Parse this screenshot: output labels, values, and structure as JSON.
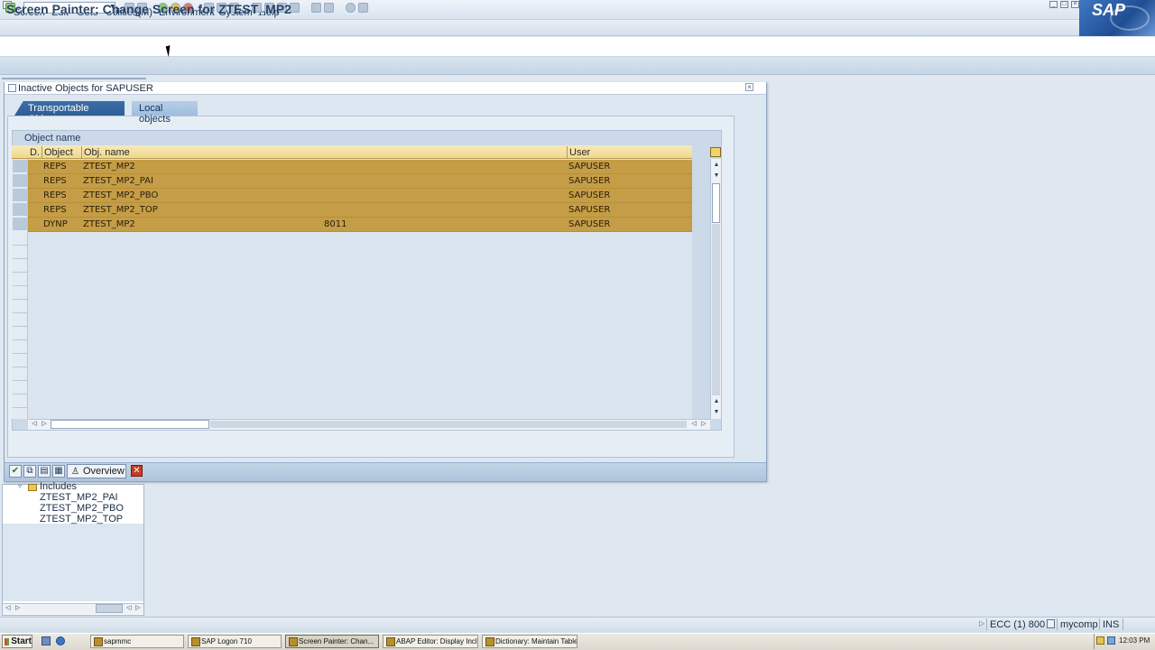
{
  "menubar": {
    "items": [
      "Screen",
      "Edit",
      "Goto",
      "Utilities(M)",
      "Environment",
      "System",
      "Help"
    ],
    "logo": "SAP"
  },
  "toolbar": {
    "command_field": ""
  },
  "title": "Screen Painter: Change Screen for ZTEST_MP2",
  "tree": {
    "folder": "Includes",
    "items": [
      "ZTEST_MP2_PAI",
      "ZTEST_MP2_PBO",
      "ZTEST_MP2_TOP"
    ]
  },
  "dialog": {
    "title": "Inactive Objects for SAPUSER",
    "tabs": [
      {
        "label": "Transportable Objects",
        "active": true
      },
      {
        "label": "Local objects",
        "active": false
      }
    ],
    "table": {
      "caption": "Object name",
      "columns": [
        "D.",
        "Object",
        "Obj. name",
        "User"
      ],
      "rows": [
        {
          "object": "REPS",
          "name": "ZTEST_MP2",
          "extra": "",
          "user": "SAPUSER"
        },
        {
          "object": "REPS",
          "name": "ZTEST_MP2_PAI",
          "extra": "",
          "user": "SAPUSER"
        },
        {
          "object": "REPS",
          "name": "ZTEST_MP2_PBO",
          "extra": "",
          "user": "SAPUSER"
        },
        {
          "object": "REPS",
          "name": "ZTEST_MP2_TOP",
          "extra": "",
          "user": "SAPUSER"
        },
        {
          "object": "DYNP",
          "name": "ZTEST_MP2",
          "extra": "8011",
          "user": "SAPUSER"
        }
      ]
    },
    "footer": {
      "overview_label": "Overview"
    }
  },
  "statusbar": {
    "system": "ECC (1) 800",
    "server": "mycomp",
    "mode": "INS"
  },
  "taskbar": {
    "start": "Start",
    "tasks": [
      {
        "label": "sapmmc",
        "active": false
      },
      {
        "label": "SAP Logon 710",
        "active": false
      },
      {
        "label": "Screen Painter: Chan...",
        "active": true
      },
      {
        "label": "ABAP Editor: Display Incl...",
        "active": false
      },
      {
        "label": "Dictionary: Maintain Table",
        "active": false
      }
    ],
    "clock": "12:03 PM"
  },
  "colors": {
    "accent": "#2f5d93",
    "selected_row": "#c59d46",
    "header": "#efd88f"
  }
}
